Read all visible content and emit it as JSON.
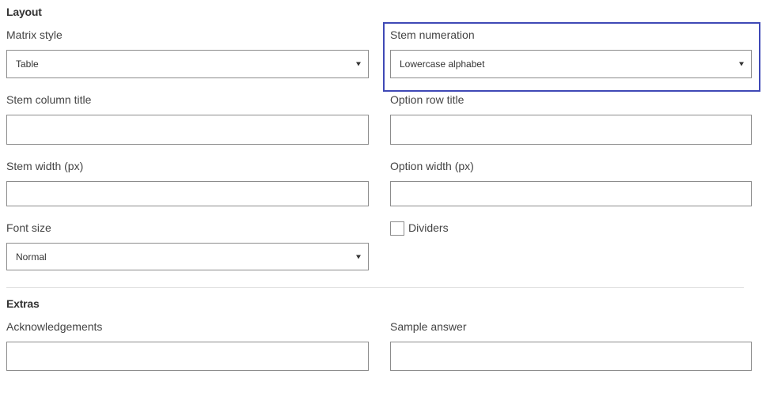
{
  "layout_section": {
    "title": "Layout",
    "matrix_style": {
      "label": "Matrix style",
      "value": "Table"
    },
    "stem_numeration": {
      "label": "Stem numeration",
      "value": "Lowercase alphabet"
    },
    "stem_column_title": {
      "label": "Stem column title",
      "value": ""
    },
    "option_row_title": {
      "label": "Option row title",
      "value": ""
    },
    "stem_width": {
      "label": "Stem width (px)",
      "value": ""
    },
    "option_width": {
      "label": "Option width (px)",
      "value": ""
    },
    "font_size": {
      "label": "Font size",
      "value": "Normal"
    },
    "dividers": {
      "label": "Dividers",
      "checked": false
    }
  },
  "extras_section": {
    "title": "Extras",
    "acknowledgements": {
      "label": "Acknowledgements",
      "value": ""
    },
    "sample_answer": {
      "label": "Sample answer",
      "value": ""
    }
  },
  "colors": {
    "highlight_border": "#3f49b6",
    "input_border": "#8c8c8c",
    "divider": "#e2e2e2"
  },
  "icons": {
    "dropdown": "caret-down-icon"
  }
}
